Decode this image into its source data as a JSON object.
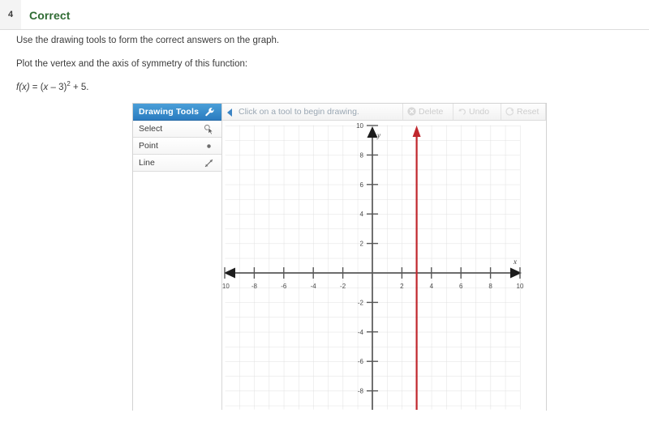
{
  "question": {
    "number": "4",
    "status": "Correct"
  },
  "prompt": {
    "instruction": "Use the drawing tools to form the correct answers on the graph.",
    "task": "Plot the vertex and the axis of symmetry of this function:",
    "formula_plain": "f(x) = (x – 3)2 + 5.",
    "formula_lhs": "f(x)",
    "formula_eq": " = (",
    "formula_var": "x",
    "formula_mid": " – 3)",
    "formula_exp": "2",
    "formula_tail": " + 5."
  },
  "drawing_tools": {
    "header_label": "Drawing Tools",
    "header_icon": "wrench-icon",
    "items": [
      {
        "label": "Select",
        "icon": "cursor-select-icon"
      },
      {
        "label": "Point",
        "icon": "point-dot-icon"
      },
      {
        "label": "Line",
        "icon": "line-arrow-icon"
      }
    ]
  },
  "status_bar": {
    "collapse_icon": "collapse-left-arrow-icon",
    "message": "Click on a tool to begin drawing.",
    "actions": [
      {
        "label": "Delete",
        "icon": "delete-circle-x-icon",
        "enabled": false
      },
      {
        "label": "Undo",
        "icon": "undo-arrow-icon",
        "enabled": false
      },
      {
        "label": "Reset",
        "icon": "reset-refresh-icon",
        "enabled": false
      }
    ]
  },
  "graph": {
    "x_axis_label": "x",
    "y_axis_label": "y",
    "x_ticks": [
      "-10",
      "-8",
      "-6",
      "-4",
      "-2",
      "2",
      "4",
      "6",
      "8",
      "10"
    ],
    "y_ticks": [
      "10",
      "8",
      "6",
      "4",
      "2",
      "-2",
      "-4",
      "-6",
      "-8"
    ],
    "grid": true,
    "badge_icon": "gold-star-icon"
  },
  "chart_data": {
    "type": "line",
    "title": "",
    "xlabel": "x",
    "ylabel": "y",
    "xlim": [
      -10.5,
      10.5
    ],
    "ylim": [
      -8.5,
      10.5
    ],
    "xticks": [
      -10,
      -8,
      -6,
      -4,
      -2,
      2,
      4,
      6,
      8,
      10
    ],
    "yticks": [
      10,
      8,
      6,
      4,
      2,
      -2,
      -4,
      -6,
      -8
    ],
    "grid": true,
    "grid_step": 1,
    "legend": "none",
    "series": [
      {
        "name": "axis of symmetry",
        "type": "vertical-line",
        "x": 3,
        "color": "#c0272d",
        "y_from": -8.5,
        "y_to": 10.4,
        "arrow_end": "top"
      }
    ],
    "annotations": [
      {
        "text": "f(x) = (x – 3)^2 + 5",
        "role": "function-definition"
      }
    ]
  },
  "colors": {
    "accent_blue": "#2b7cc0",
    "correct_green": "#2f6b33",
    "symmetry_red": "#c0272d",
    "star_gold": "#f4cf3e",
    "grid_gray": "#dcdcdc",
    "axis_gray": "#575757"
  }
}
